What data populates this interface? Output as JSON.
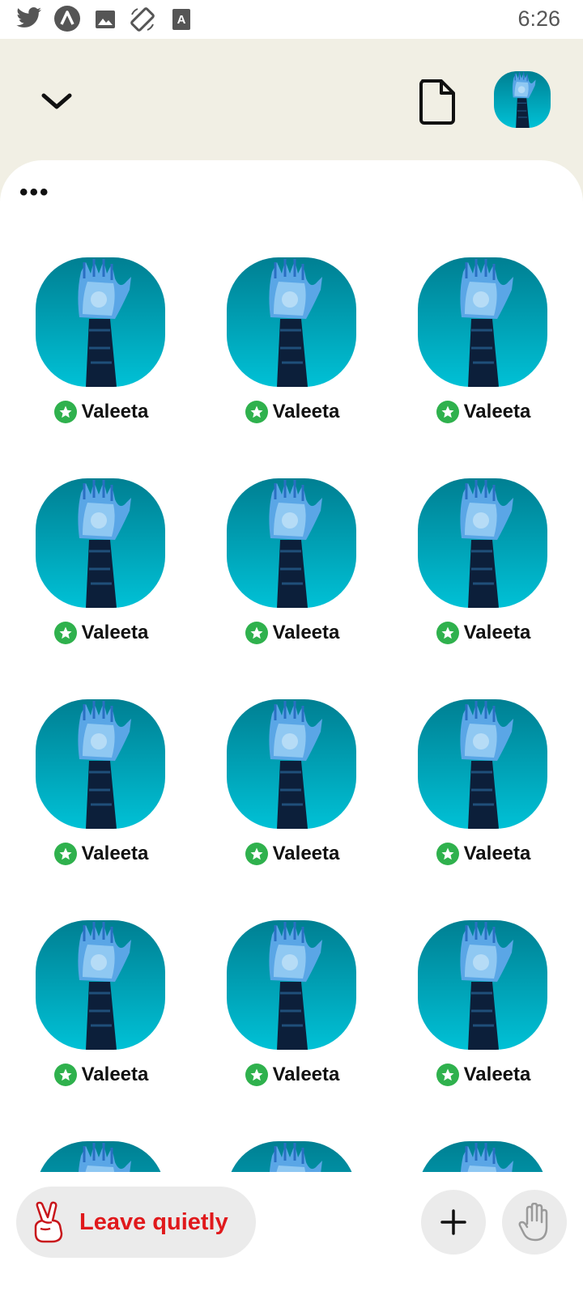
{
  "status_bar": {
    "time": "6:26",
    "icons": [
      "twitter-icon",
      "app-notification-icon",
      "image-icon",
      "screen-rotation-icon",
      "text-a-icon"
    ]
  },
  "header": {
    "collapse_icon": "chevron-down-icon",
    "document_icon": "document-icon",
    "avatar_icon": "robot-hand-avatar"
  },
  "sheet": {
    "more_label": "•••"
  },
  "listeners": [
    {
      "name": "Valeeta",
      "badge": "star-badge"
    },
    {
      "name": "Valeeta",
      "badge": "star-badge"
    },
    {
      "name": "Valeeta",
      "badge": "star-badge"
    },
    {
      "name": "Valeeta",
      "badge": "star-badge"
    },
    {
      "name": "Valeeta",
      "badge": "star-badge"
    },
    {
      "name": "Valeeta",
      "badge": "star-badge"
    },
    {
      "name": "Valeeta",
      "badge": "star-badge"
    },
    {
      "name": "Valeeta",
      "badge": "star-badge"
    },
    {
      "name": "Valeeta",
      "badge": "star-badge"
    },
    {
      "name": "Valeeta",
      "badge": "star-badge"
    },
    {
      "name": "Valeeta",
      "badge": "star-badge"
    },
    {
      "name": "Valeeta",
      "badge": "star-badge"
    },
    {
      "name": "",
      "badge": ""
    },
    {
      "name": "",
      "badge": ""
    },
    {
      "name": "",
      "badge": ""
    }
  ],
  "bottom_bar": {
    "leave_label": "Leave quietly",
    "leave_icon": "peace-hand-icon",
    "add_icon": "plus-icon",
    "raise_hand_icon": "raise-hand-icon"
  },
  "colors": {
    "background_top": "#f1efe4",
    "accent_red": "#e0191c",
    "badge_green": "#2fb14d",
    "avatar_teal": "#00a7bd"
  }
}
